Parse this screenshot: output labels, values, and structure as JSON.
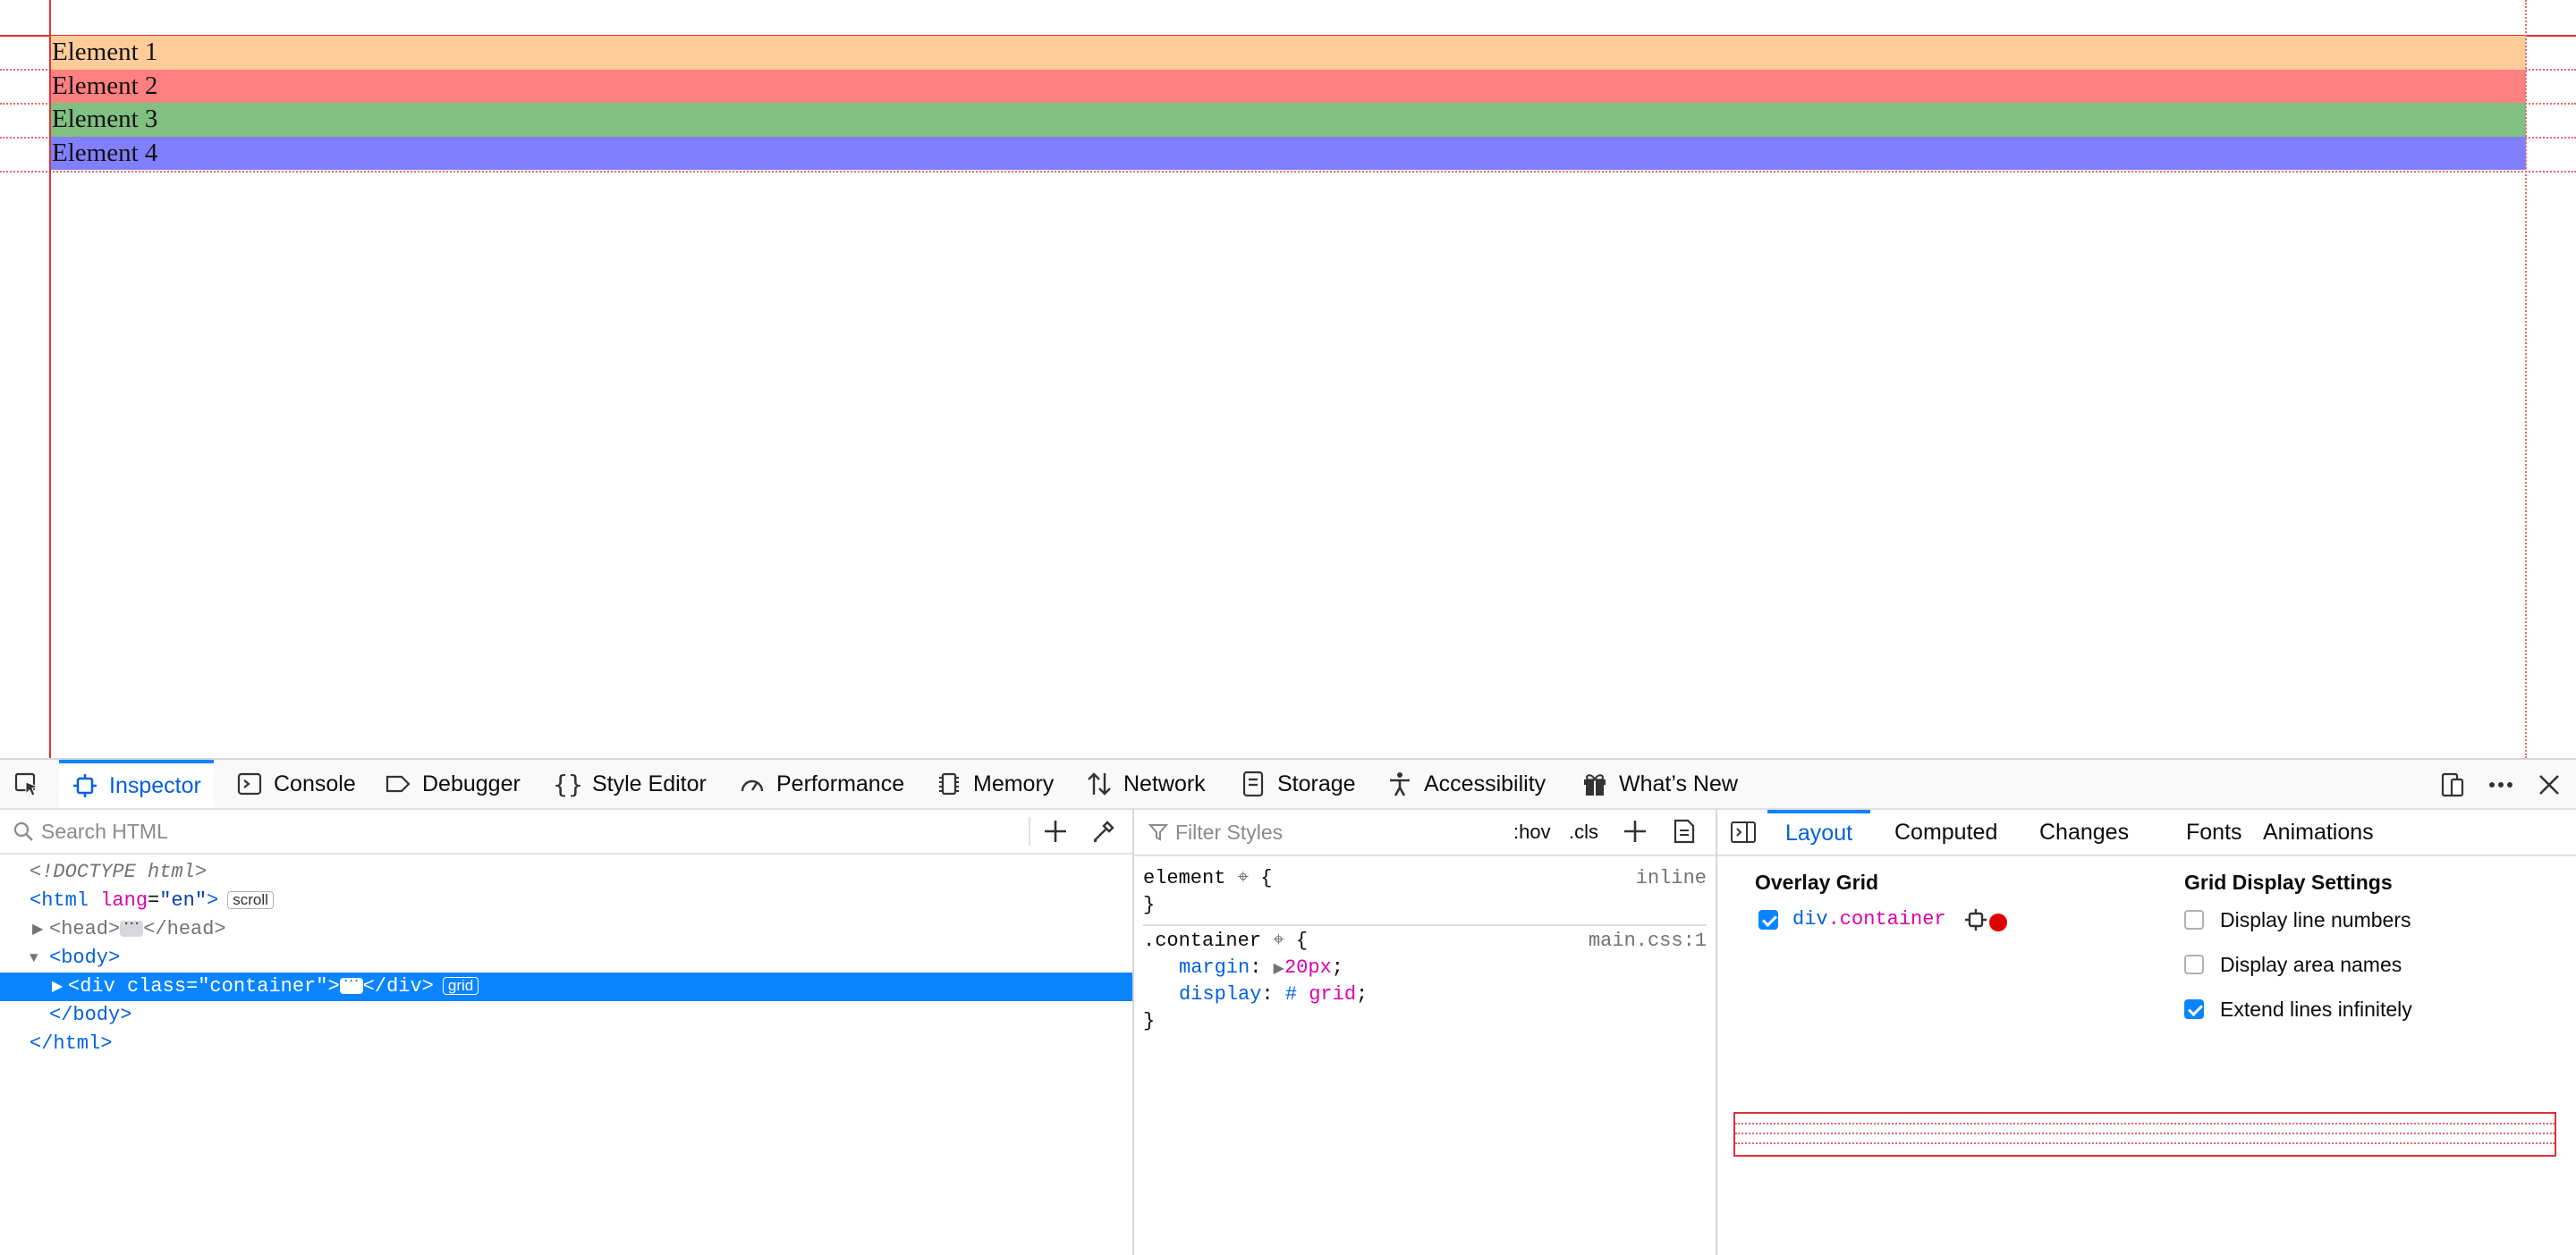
{
  "page": {
    "elements": [
      "Element 1",
      "Element 2",
      "Element 3",
      "Element 4"
    ],
    "element_colors": [
      "#ffcc99",
      "#ff8080",
      "#80c080",
      "#8080ff"
    ]
  },
  "toolbar": {
    "tabs": [
      {
        "label": "Inspector",
        "icon": "inspector-icon",
        "active": true
      },
      {
        "label": "Console",
        "icon": "console-icon"
      },
      {
        "label": "Debugger",
        "icon": "debugger-icon"
      },
      {
        "label": "Style Editor",
        "icon": "braces-icon"
      },
      {
        "label": "Performance",
        "icon": "gauge-icon"
      },
      {
        "label": "Memory",
        "icon": "memory-chip-icon"
      },
      {
        "label": "Network",
        "icon": "arrows-up-down-icon"
      },
      {
        "label": "Storage",
        "icon": "storage-icon"
      },
      {
        "label": "Accessibility",
        "icon": "accessibility-person-icon"
      },
      {
        "label": "What’s New",
        "icon": "gift-icon"
      }
    ]
  },
  "markup": {
    "search_placeholder": "Search HTML",
    "doctype": "<!DOCTYPE html>",
    "html_tag": "html",
    "html_attr": "lang",
    "html_attr_value": "\"en\"",
    "scroll_badge": "scroll",
    "head_open": "<head>",
    "head_close": "</head>",
    "body_open": "body",
    "div_open_tag": "div",
    "div_attr": "class",
    "div_attr_value": "\"container\"",
    "div_close": "</div>",
    "grid_badge": "grid",
    "body_close": "body",
    "html_close": "html"
  },
  "rules": {
    "filter_placeholder": "Filter Styles",
    "hov": ":hov",
    "cls": ".cls",
    "element_selector": "element",
    "element_source": "inline",
    "container_selector": ".container",
    "container_source": "main.css:1",
    "margin_prop": "margin",
    "margin_value": "20px",
    "display_prop": "display",
    "display_value": "grid"
  },
  "layout": {
    "tabs": [
      "Layout",
      "Computed",
      "Changes",
      "Fonts",
      "Animations"
    ],
    "overlay_grid_title": "Overlay Grid",
    "grid_item_tag": "div",
    "grid_item_class": ".container",
    "grid_item_color": "#e00000",
    "settings_title": "Grid Display Settings",
    "options": [
      {
        "label": "Display line numbers",
        "checked": false
      },
      {
        "label": "Display area names",
        "checked": false
      },
      {
        "label": "Extend lines infinitely",
        "checked": true
      }
    ]
  }
}
